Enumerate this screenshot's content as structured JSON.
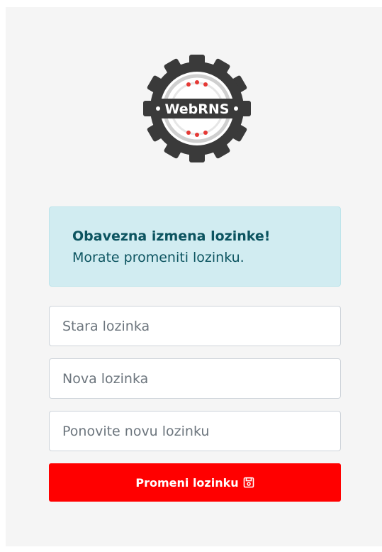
{
  "logo": {
    "text": "WebRNS",
    "icon": "gear-logo"
  },
  "alert": {
    "title": "Obavezna izmena lozinke!",
    "message": "Morate promeniti lozinku."
  },
  "form": {
    "old_password_placeholder": "Stara lozinka",
    "new_password_placeholder": "Nova lozinka",
    "repeat_password_placeholder": "Ponovite novu lozinku",
    "submit_label": "Promeni lozinku",
    "submit_icon": "save-icon"
  },
  "colors": {
    "accent": "#ff0000",
    "alert_bg": "#d1ecf1",
    "alert_text": "#0c5460",
    "page_bg": "#f5f5f5"
  }
}
